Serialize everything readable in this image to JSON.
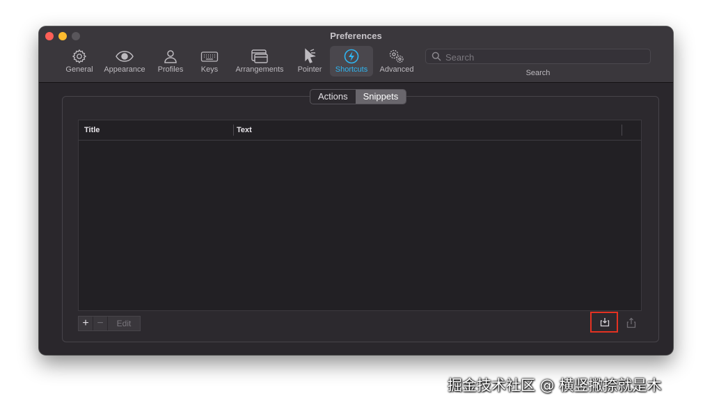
{
  "window": {
    "title": "Preferences"
  },
  "toolbar": {
    "items": [
      {
        "label": "General",
        "icon": "gear-icon"
      },
      {
        "label": "Appearance",
        "icon": "eye-icon"
      },
      {
        "label": "Profiles",
        "icon": "person-icon"
      },
      {
        "label": "Keys",
        "icon": "keyboard-icon"
      },
      {
        "label": "Arrangements",
        "icon": "windows-icon"
      },
      {
        "label": "Pointer",
        "icon": "pointer-icon"
      },
      {
        "label": "Shortcuts",
        "icon": "lightning-icon",
        "active": true
      },
      {
        "label": "Advanced",
        "icon": "gears-icon"
      }
    ],
    "search": {
      "placeholder": "Search",
      "label": "Search"
    }
  },
  "tabs": {
    "actions": "Actions",
    "snippets": "Snippets",
    "selected": "Snippets"
  },
  "table": {
    "columns": [
      "Title",
      "Text"
    ],
    "rows": []
  },
  "footer": {
    "add": "+",
    "remove": "−",
    "edit": "Edit"
  },
  "watermark": "掘金技术社区 @ 横竖撇捺就是木",
  "colors": {
    "accent": "#2fb6f2",
    "highlight": "#e53222"
  }
}
